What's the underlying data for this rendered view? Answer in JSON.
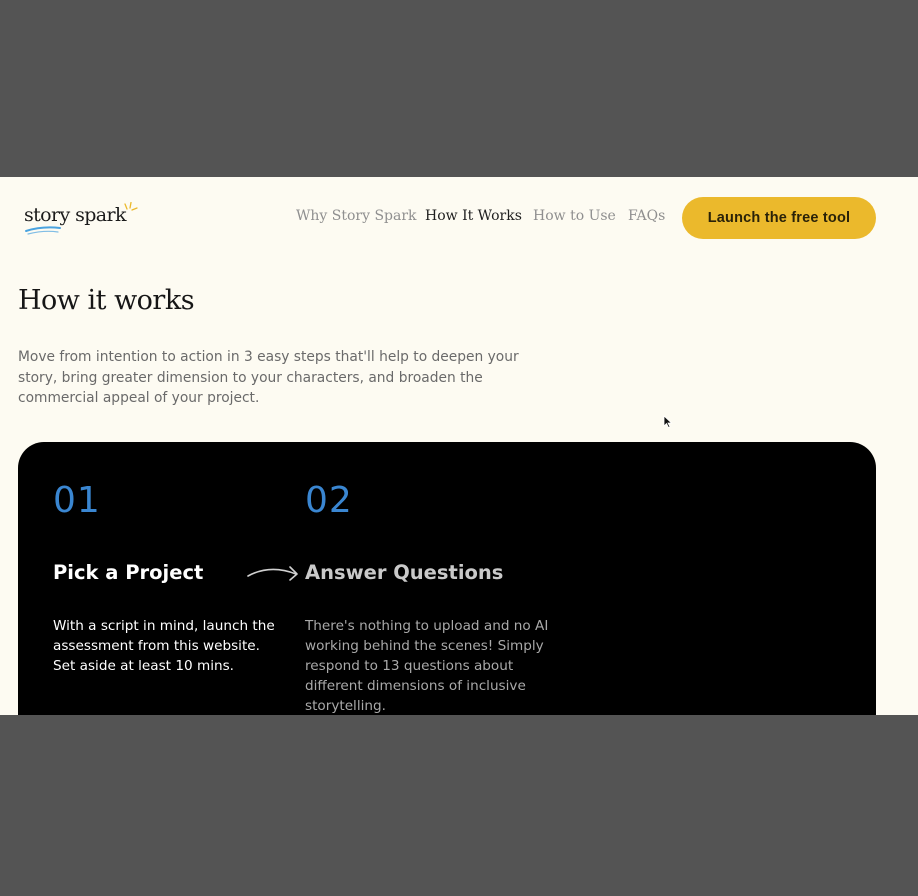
{
  "header": {
    "logo_text": "story spark",
    "nav": [
      {
        "label": "Why Story Spark",
        "active": false
      },
      {
        "label": "How It Works",
        "active": true
      },
      {
        "label": "How to Use",
        "active": false
      },
      {
        "label": "FAQs",
        "active": false
      }
    ],
    "cta_label": "Launch the free tool"
  },
  "main": {
    "title": "How it works",
    "intro": "Move from intention to action in 3 easy steps that'll help to deepen your story, bring greater dimension to your characters, and broaden the commercial appeal of your project.",
    "steps": [
      {
        "number": "01",
        "title": "Pick a Project",
        "description": "With a script in mind, launch the assessment from this website. Set aside at least 10 mins."
      },
      {
        "number": "02",
        "title": "Answer Questions",
        "description": "There's nothing to upload and no AI working behind the scenes! Simply respond to 13 questions about different dimensions of inclusive storytelling."
      }
    ]
  },
  "colors": {
    "page_background": "#fdfbf2",
    "frame_background": "#545454",
    "cta_background": "#ebb92c",
    "step_number": "#3a86d1",
    "steps_panel": "#000000"
  },
  "icons": [
    "logo-underline-swoosh-icon",
    "logo-spark-icon",
    "arrow-right-icon",
    "mouse-cursor-icon"
  ]
}
